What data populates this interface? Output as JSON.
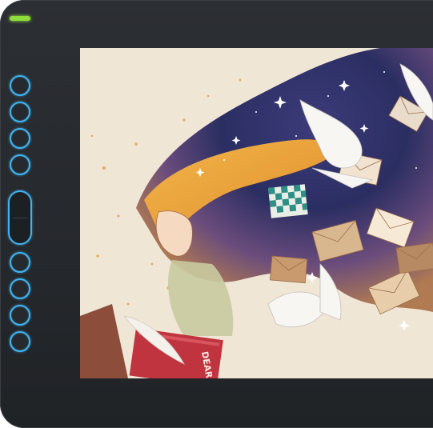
{
  "device": {
    "led_color": "#8fdc3a",
    "key_color": "#3fb4f0",
    "express_keys": [
      "key-1",
      "key-2",
      "key-3",
      "key-4",
      "key-5",
      "key-6",
      "key-7",
      "key-8",
      "key-9",
      "key-10",
      "key-11"
    ]
  },
  "artwork": {
    "book_text": "DEAR"
  }
}
